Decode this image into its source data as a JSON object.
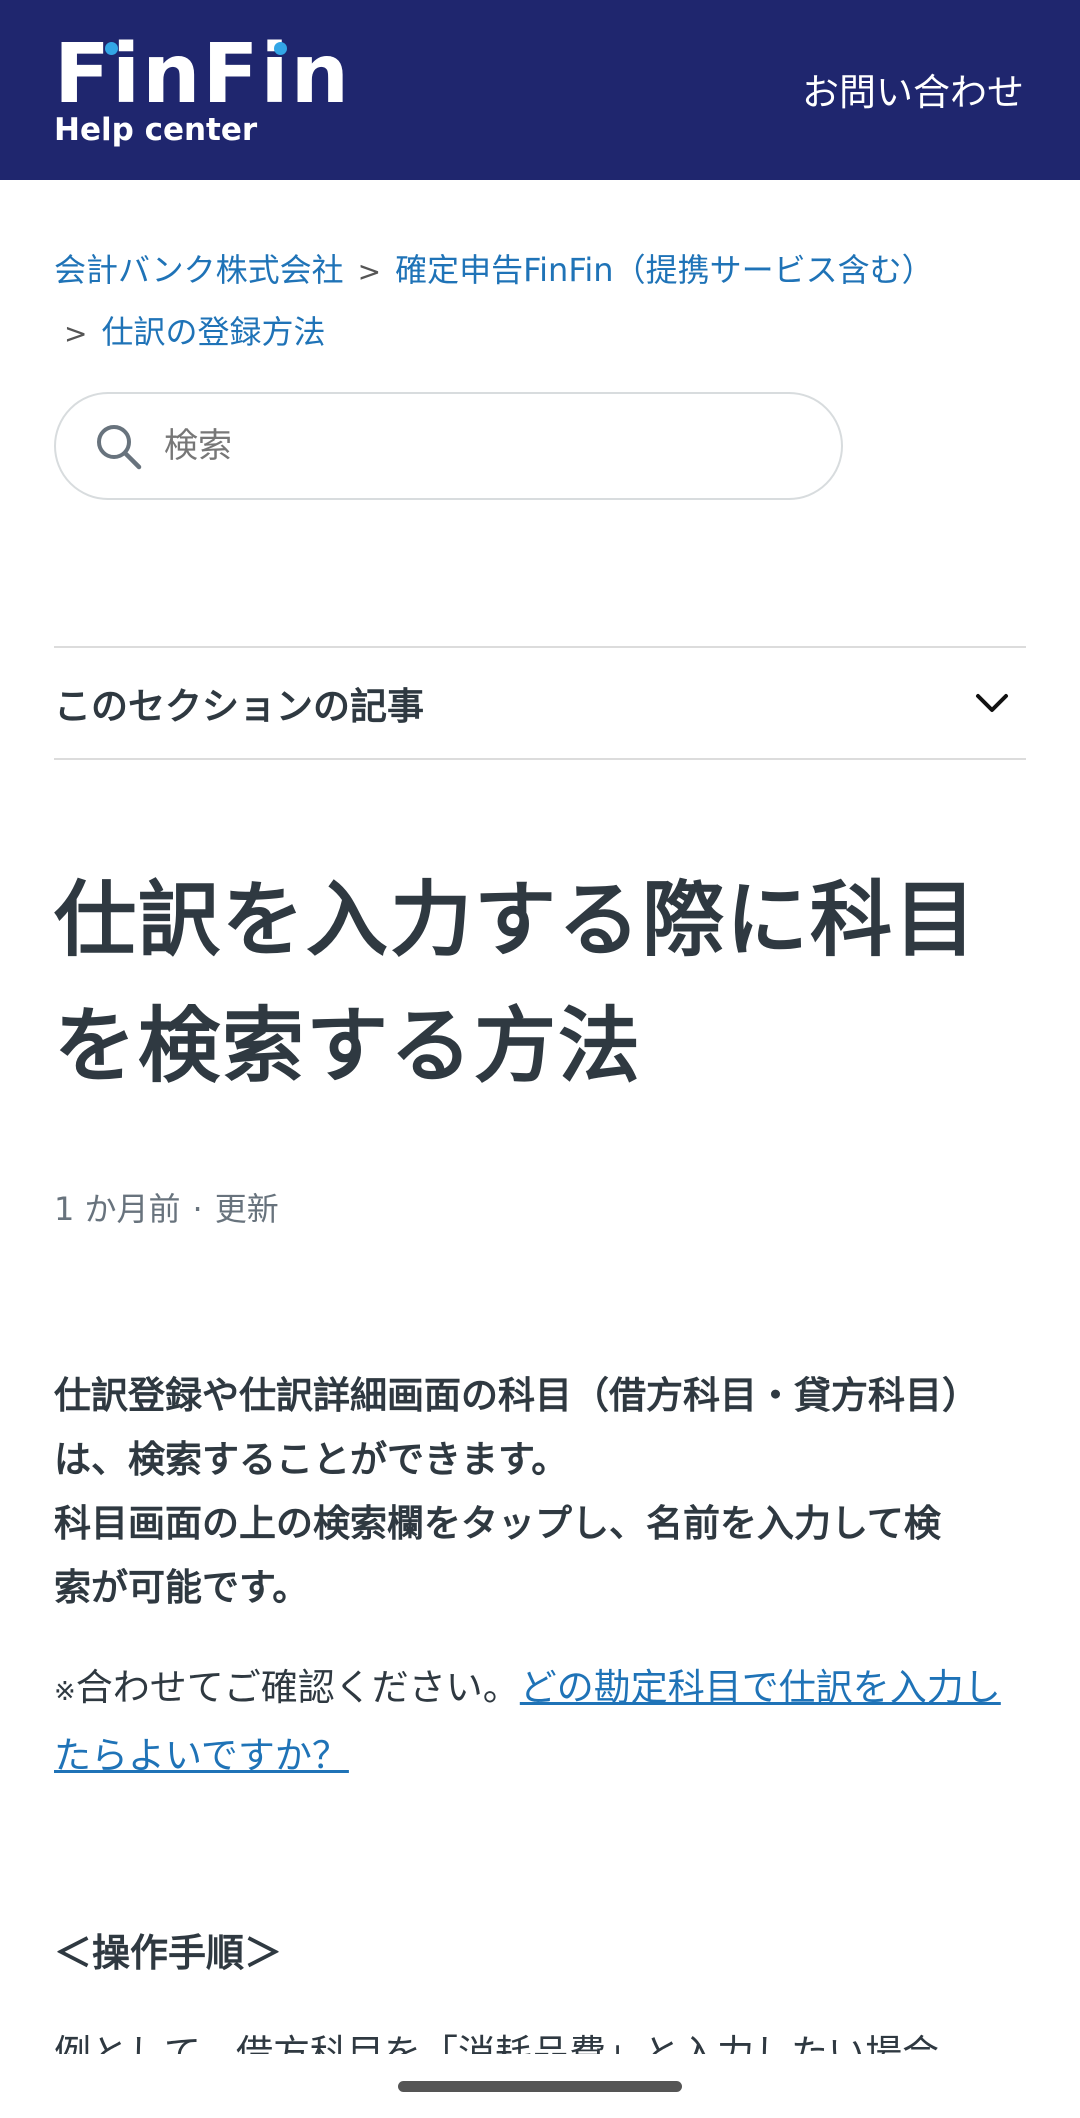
{
  "header": {
    "logo_text": "FinFin",
    "logo_sub": "Help center",
    "contact_label": "お問い合わせ",
    "background_color": "#1f266e",
    "logo_dot_color": "#33a6e6"
  },
  "breadcrumb": {
    "items": [
      "会計バンク株式会社",
      "確定申告FinFin（提携サービス含む）",
      "仕訳の登録方法"
    ],
    "separator": ">"
  },
  "search": {
    "placeholder": "検索",
    "icon": "search-icon"
  },
  "section": {
    "label": "このセクションの記事",
    "icon": "chevron-down-icon"
  },
  "article": {
    "title": "仕訳を入力する際に科目を検索する方法",
    "updated_ago": "1 か月前",
    "updated_label": "更新",
    "body_lines": [
      "仕訳登録や仕訳詳細画面の科目（借方科目・貸方科目）",
      "は、検索することができます。",
      "科目画面の上の検索欄をタップし、名前を入力して検",
      "索が可能です。"
    ],
    "note_mark": "※",
    "note_text": "合わせてご確認ください。",
    "note_link": "どの勘定科目で仕訳を入力したらよいですか？",
    "steps_heading": "＜操作手順＞",
    "cutoff_text": "例として、借方科目を「消耗品費」と入力したい場合"
  },
  "colors": {
    "link": "#1f73b7",
    "text": "#2f3941"
  }
}
